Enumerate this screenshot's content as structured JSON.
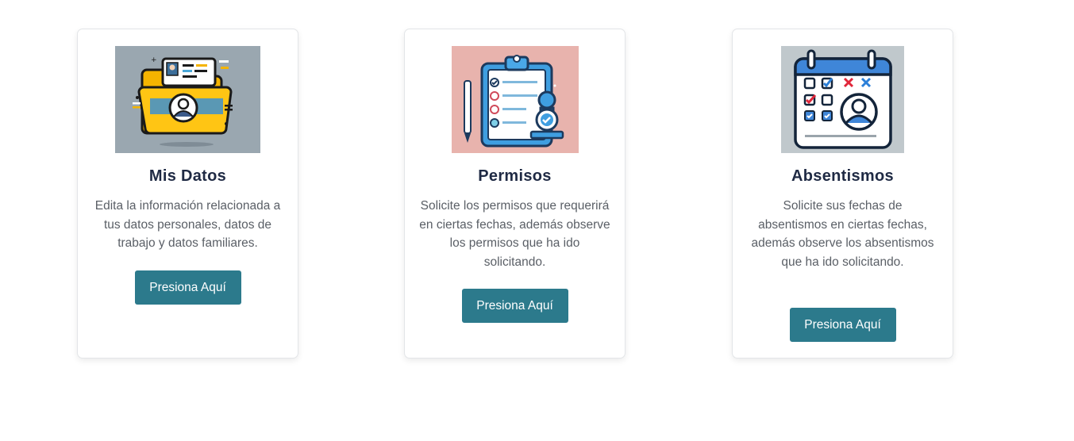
{
  "cards": [
    {
      "title": "Mis Datos",
      "description": "Edita la información relacionada a tus datos personales, datos de trabajo y datos familiares.",
      "button_label": "Presiona Aquí",
      "icon": "folder-user-icon"
    },
    {
      "title": "Permisos",
      "description": "Solicite los permisos que requerirá en ciertas fechas, además observe los permisos que ha ido solicitando.",
      "button_label": "Presiona Aquí",
      "icon": "clipboard-checklist-icon"
    },
    {
      "title": "Absentismos",
      "description": "Solicite sus fechas de absentismos en ciertas fechas, además observe los absentismos que ha ido solicitando.",
      "button_label": "Presiona Aquí",
      "icon": "calendar-absence-icon"
    }
  ],
  "colors": {
    "button_bg": "#2c7a8c",
    "title_text": "#1f2a44",
    "body_text": "#5a5f66"
  }
}
